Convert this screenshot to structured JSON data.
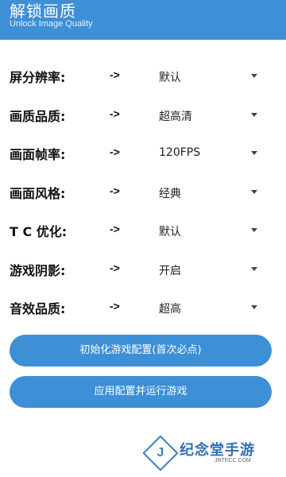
{
  "header": {
    "title": "解锁画质",
    "subtitle": "Unlock Image Quality"
  },
  "settings": [
    {
      "label": "屏分辨率:",
      "arrow": "->",
      "value": "默认"
    },
    {
      "label": "画质品质:",
      "arrow": "->",
      "value": "超高清"
    },
    {
      "label": "画面帧率:",
      "arrow": "->",
      "value": "120FPS"
    },
    {
      "label": "画面风格:",
      "arrow": "->",
      "value": "经典"
    },
    {
      "label": "T C 优化:",
      "arrow": "->",
      "value": "默认"
    },
    {
      "label": "游戏阴影:",
      "arrow": "->",
      "value": "开启"
    },
    {
      "label": "音效品质:",
      "arrow": "->",
      "value": "超高"
    }
  ],
  "buttons": {
    "init": "初始化游戏配置(首次必点)",
    "apply": "应用配置并运行游戏"
  },
  "watermark": {
    "text": "纪念堂手游",
    "url": "JNTECC.COM"
  },
  "colors": {
    "accent": "#3d8fd6"
  }
}
